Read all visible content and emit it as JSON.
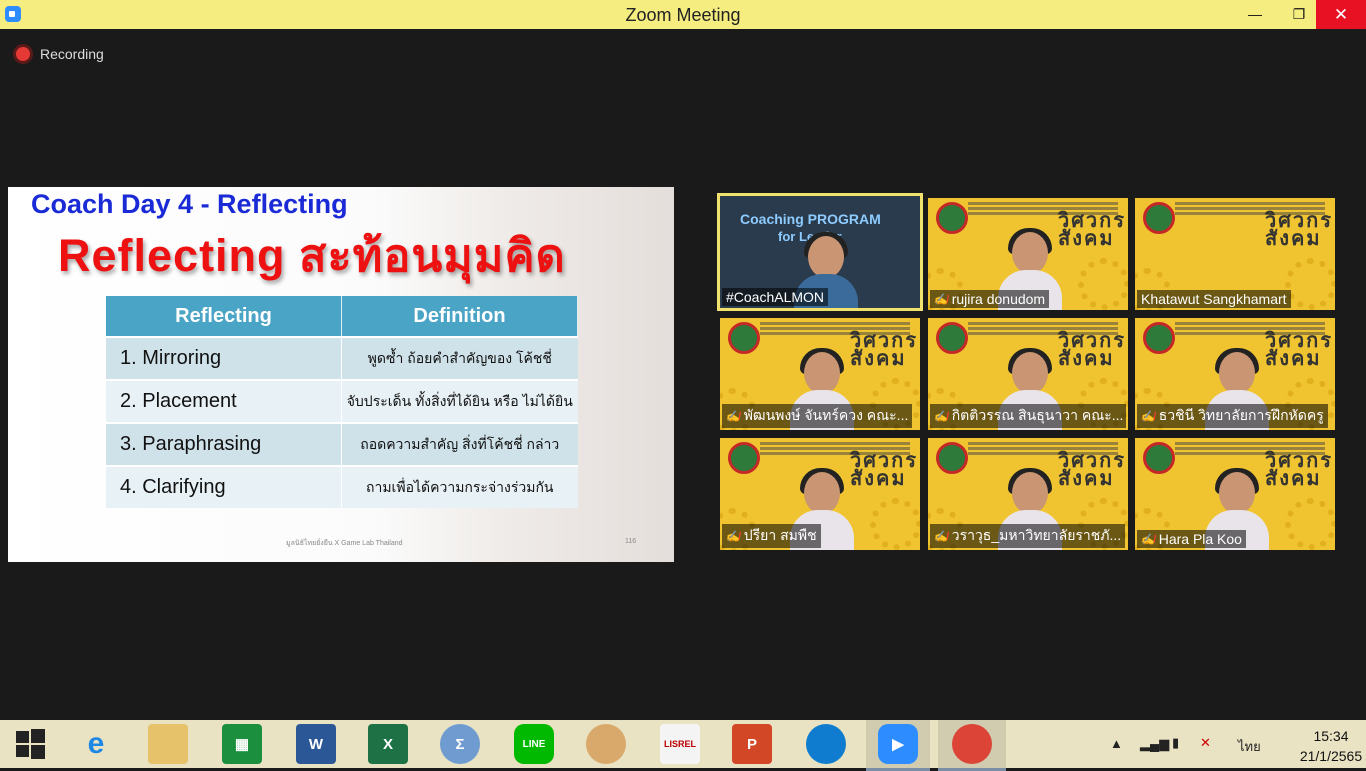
{
  "window": {
    "title": "Zoom Meeting"
  },
  "recording": {
    "label": "Recording"
  },
  "slide": {
    "title": "Coach Day 4 - Reflecting",
    "heading": "Reflecting สะท้อนมุมคิด",
    "table_headers": [
      "Reflecting",
      "Definition"
    ],
    "rows": [
      {
        "term": "1. Mirroring",
        "definition": "พูดซ้ำ ถ้อยคำสำคัญของ โค้ชชี่"
      },
      {
        "term": "2. Placement",
        "definition": "จับประเด็น ทั้งสิ่งที่ได้ยิน หรือ ไม่ได้ยิน"
      },
      {
        "term": "3. Paraphrasing",
        "definition": "ถอดความสำคัญ สิ่งที่โค้ชชี่ กล่าว"
      },
      {
        "term": "4. Clarifying",
        "definition": "ถามเพื่อได้ความกระจ่างร่วมกัน"
      }
    ],
    "footer": "มูลนิธิไทยยั่งยืน X Game Lab Thailand",
    "page_number": "116"
  },
  "participants": [
    {
      "name": "#CoachALMON",
      "muted": false,
      "speaker": true,
      "banner": "Coaching PROGRAM",
      "banner2": "for Leader"
    },
    {
      "name": "rujira donudom",
      "muted": true
    },
    {
      "name": "Khatawut Sangkhamart",
      "muted": false
    },
    {
      "name": "พัฒนพงษ์ จันทร์ควง คณะ...",
      "muted": true
    },
    {
      "name": "กิตติวรรณ สินธุนาวา คณะ...",
      "muted": true
    },
    {
      "name": "ธวชินี  วิทยาลัยการฝึกหัดครู",
      "muted": true
    },
    {
      "name": "ปรียา สมพืช",
      "muted": true
    },
    {
      "name": "วราวุธ_มหาวิทยาลัยราชภั...",
      "muted": true
    },
    {
      "name": "Hara Pla Koo",
      "muted": true
    }
  ],
  "tile_brand": "วิศวกร\nสังคม",
  "taskbar": {
    "apps": [
      "Start",
      "Internet Explorer",
      "File Explorer",
      "Store",
      "Word",
      "Excel",
      "Math Input",
      "LINE",
      "Paint",
      "LISREL",
      "PowerPoint",
      "Edge",
      "Zoom",
      "Chrome"
    ],
    "language": "ไทย",
    "time": "15:34",
    "date": "21/1/2565"
  },
  "colors": {
    "titlebar": "#f5ed80",
    "tile_bg": "#f0c430",
    "slide_title": "#1a2ad6",
    "slide_heading": "#ee1111",
    "table_header": "#4aa4c6"
  }
}
